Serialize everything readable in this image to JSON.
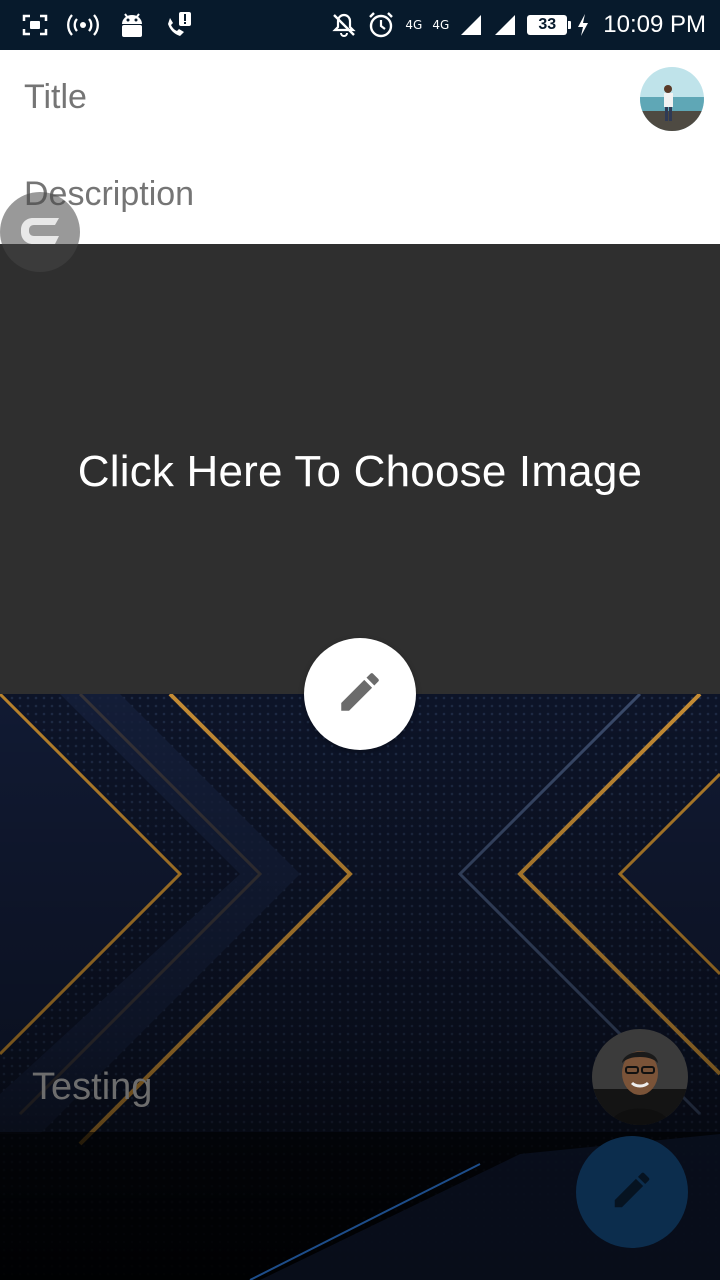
{
  "status_bar": {
    "time": "10:09 PM",
    "battery": "33",
    "network_label_1": "4G",
    "network_label_2": "4G",
    "icons": [
      "screenshot-icon",
      "hotspot-icon",
      "android-icon",
      "call-alert-icon",
      "mute-icon",
      "alarm-icon",
      "signal-icon",
      "battery-icon",
      "charging-icon"
    ]
  },
  "form": {
    "title_placeholder": "Title",
    "description_placeholder": "Description"
  },
  "chooser": {
    "label": "Click Here To Choose Image"
  },
  "card": {
    "caption": "Testing"
  },
  "colors": {
    "status_bar": "#071a2c",
    "chooser_bg": "#2f2f2f",
    "fab_dark": "#0c2d4d"
  }
}
